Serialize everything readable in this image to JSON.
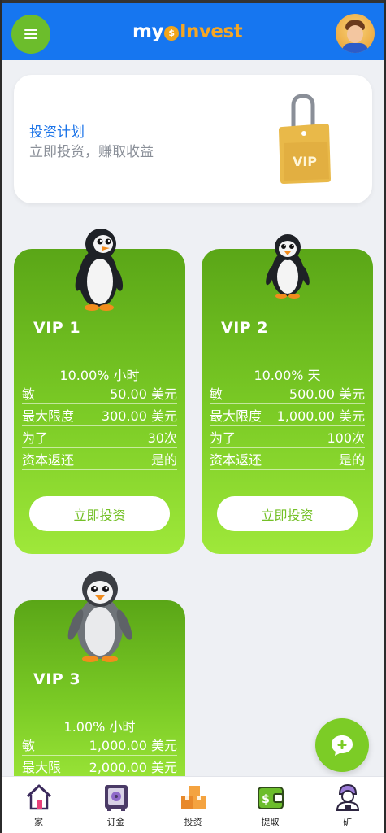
{
  "header": {
    "logo_my": "my",
    "logo_coin": "$",
    "logo_invest": "Invest"
  },
  "plan": {
    "title": "投资计划",
    "subtitle": "立即投资，赚取收益",
    "tag_text": "VIP"
  },
  "vip_plans": [
    {
      "name": "VIP 1",
      "rate": "10.00% 小时",
      "rows": [
        {
          "label": "敏",
          "value": "50.00 美元"
        },
        {
          "label": "最大限度",
          "value": "300.00 美元"
        },
        {
          "label": "为了",
          "value": "30次"
        },
        {
          "label": "资本返还",
          "value": "是的"
        }
      ],
      "button": "立即投资"
    },
    {
      "name": "VIP 2",
      "rate": "10.00% 天",
      "rows": [
        {
          "label": "敏",
          "value": "500.00 美元"
        },
        {
          "label": "最大限度",
          "value": "1,000.00 美元"
        },
        {
          "label": "为了",
          "value": "100次"
        },
        {
          "label": "资本返还",
          "value": "是的"
        }
      ],
      "button": "立即投资"
    },
    {
      "name": "VIP 3",
      "rate": "1.00% 小时",
      "rows": [
        {
          "label": "敏",
          "value": "1,000.00 美元"
        },
        {
          "label": "最大限",
          "value": "2,000.00 美元"
        }
      ]
    }
  ],
  "bottom_nav": [
    {
      "label": "家",
      "icon": "home-icon"
    },
    {
      "label": "订金",
      "icon": "safe-icon"
    },
    {
      "label": "投资",
      "icon": "boxes-icon"
    },
    {
      "label": "提取",
      "icon": "wallet-icon"
    },
    {
      "label": "矿",
      "icon": "miner-icon"
    }
  ],
  "colors": {
    "header_blue": "#1676f0",
    "accent_green": "#7ccc26",
    "link_blue": "#1a73e8"
  }
}
